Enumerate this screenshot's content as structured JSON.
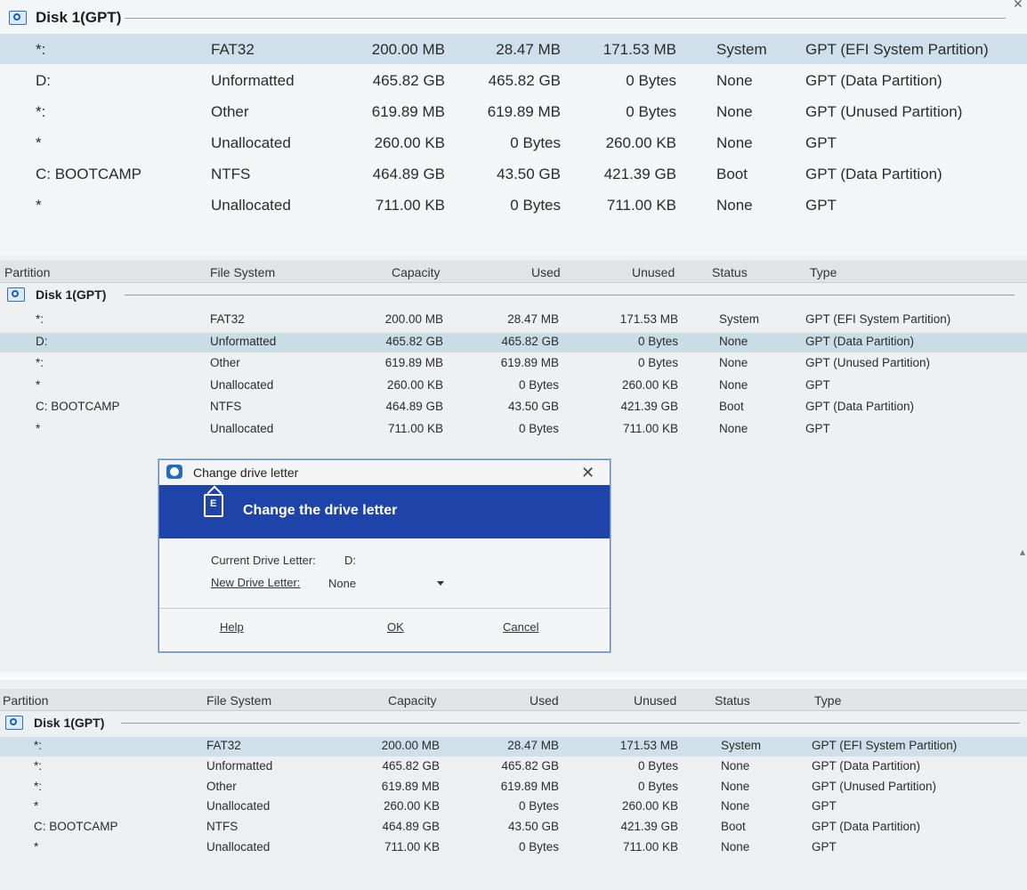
{
  "columns": {
    "partition": "Partition",
    "file_system": "File System",
    "capacity": "Capacity",
    "used": "Used",
    "unused": "Unused",
    "status": "Status",
    "type": "Type"
  },
  "disk": {
    "label": "Disk 1(GPT)"
  },
  "panel1_rows": [
    {
      "partition": "*:",
      "fs": "FAT32",
      "capacity": "200.00 MB",
      "used": "28.47 MB",
      "unused": "171.53 MB",
      "status": "System",
      "type": "GPT (EFI System Partition)"
    },
    {
      "partition": "D:",
      "fs": "Unformatted",
      "capacity": "465.82 GB",
      "used": "465.82 GB",
      "unused": "0 Bytes",
      "status": "None",
      "type": "GPT (Data Partition)"
    },
    {
      "partition": "*:",
      "fs": "Other",
      "capacity": "619.89 MB",
      "used": "619.89 MB",
      "unused": "0 Bytes",
      "status": "None",
      "type": "GPT (Unused Partition)"
    },
    {
      "partition": "*",
      "fs": "Unallocated",
      "capacity": "260.00 KB",
      "used": "0 Bytes",
      "unused": "260.00 KB",
      "status": "None",
      "type": "GPT"
    },
    {
      "partition": "C: BOOTCAMP",
      "fs": "NTFS",
      "capacity": "464.89 GB",
      "used": "43.50 GB",
      "unused": "421.39 GB",
      "status": "Boot",
      "type": "GPT (Data Partition)"
    },
    {
      "partition": "*",
      "fs": "Unallocated",
      "capacity": "711.00 KB",
      "used": "0 Bytes",
      "unused": "711.00 KB",
      "status": "None",
      "type": "GPT"
    }
  ],
  "panel2_rows": [
    {
      "partition": "*:",
      "fs": "FAT32",
      "capacity": "200.00 MB",
      "used": "28.47 MB",
      "unused": "171.53 MB",
      "status": "System",
      "type": "GPT (EFI System Partition)"
    },
    {
      "partition": "D:",
      "fs": "Unformatted",
      "capacity": "465.82 GB",
      "used": "465.82 GB",
      "unused": "0 Bytes",
      "status": "None",
      "type": "GPT (Data Partition)"
    },
    {
      "partition": "*:",
      "fs": "Other",
      "capacity": "619.89 MB",
      "used": "619.89 MB",
      "unused": "0 Bytes",
      "status": "None",
      "type": "GPT (Unused Partition)"
    },
    {
      "partition": "*",
      "fs": "Unallocated",
      "capacity": "260.00 KB",
      "used": "0 Bytes",
      "unused": "260.00 KB",
      "status": "None",
      "type": "GPT"
    },
    {
      "partition": "C: BOOTCAMP",
      "fs": "NTFS",
      "capacity": "464.89 GB",
      "used": "43.50 GB",
      "unused": "421.39 GB",
      "status": "Boot",
      "type": "GPT (Data Partition)"
    },
    {
      "partition": "*",
      "fs": "Unallocated",
      "capacity": "711.00 KB",
      "used": "0 Bytes",
      "unused": "711.00 KB",
      "status": "None",
      "type": "GPT"
    }
  ],
  "panel3_rows": [
    {
      "partition": "*:",
      "fs": "FAT32",
      "capacity": "200.00 MB",
      "used": "28.47 MB",
      "unused": "171.53 MB",
      "status": "System",
      "type": "GPT (EFI System Partition)"
    },
    {
      "partition": "*:",
      "fs": "Unformatted",
      "capacity": "465.82 GB",
      "used": "465.82 GB",
      "unused": "0 Bytes",
      "status": "None",
      "type": "GPT (Data Partition)"
    },
    {
      "partition": "*:",
      "fs": "Other",
      "capacity": "619.89 MB",
      "used": "619.89 MB",
      "unused": "0 Bytes",
      "status": "None",
      "type": "GPT (Unused Partition)"
    },
    {
      "partition": "*",
      "fs": "Unallocated",
      "capacity": "260.00 KB",
      "used": "0 Bytes",
      "unused": "260.00 KB",
      "status": "None",
      "type": "GPT"
    },
    {
      "partition": "C: BOOTCAMP",
      "fs": "NTFS",
      "capacity": "464.89 GB",
      "used": "43.50 GB",
      "unused": "421.39 GB",
      "status": "Boot",
      "type": "GPT (Data Partition)"
    },
    {
      "partition": "*",
      "fs": "Unallocated",
      "capacity": "711.00 KB",
      "used": "0 Bytes",
      "unused": "711.00 KB",
      "status": "None",
      "type": "GPT"
    }
  ],
  "dialog": {
    "title": "Change drive letter",
    "banner": "Change the drive letter",
    "current_label": "Current Drive Letter:",
    "current_value": "D:",
    "new_label": "New Drive Letter:",
    "new_value": "None",
    "help": "Help",
    "ok": "OK",
    "cancel": "Cancel",
    "close_glyph": "✕"
  },
  "colors": {
    "accent": "#1e44a9",
    "selection": "#cfe0ea"
  }
}
